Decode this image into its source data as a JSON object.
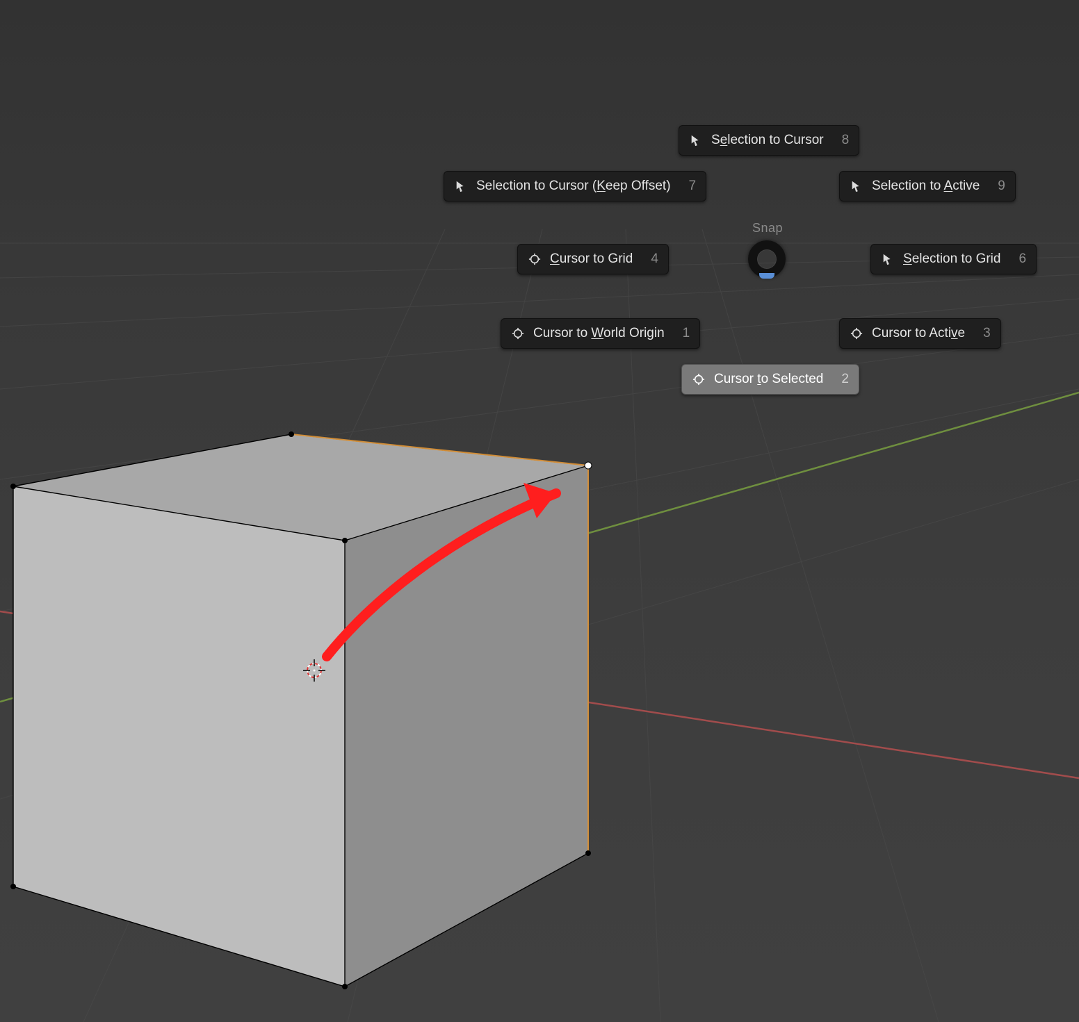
{
  "pie_menu": {
    "title": "Snap",
    "items": {
      "selection_to_cursor": {
        "label_pre": "S",
        "label_u": "e",
        "label_post": "lection to Cursor",
        "shortcut": "8",
        "icon": "cursor-arrow"
      },
      "selection_to_cursor_offset": {
        "label_pre": "Selection to Cursor (",
        "label_u": "K",
        "label_post": "eep Offset)",
        "shortcut": "7",
        "icon": "cursor-arrow"
      },
      "selection_to_active": {
        "label_pre": "Selection to ",
        "label_u": "A",
        "label_post": "ctive",
        "shortcut": "9",
        "icon": "cursor-arrow"
      },
      "cursor_to_grid": {
        "label_pre": "",
        "label_u": "C",
        "label_post": "ursor to Grid",
        "shortcut": "4",
        "icon": "cursor-target"
      },
      "selection_to_grid": {
        "label_pre": "",
        "label_u": "S",
        "label_post": "election to Grid",
        "shortcut": "6",
        "icon": "cursor-arrow"
      },
      "cursor_to_world_origin": {
        "label_pre": "Cursor to ",
        "label_u": "W",
        "label_post": "orld Origin",
        "shortcut": "1",
        "icon": "cursor-target"
      },
      "cursor_to_active": {
        "label_pre": "Cursor to Acti",
        "label_u": "v",
        "label_post": "e",
        "shortcut": "3",
        "icon": "cursor-target"
      },
      "cursor_to_selected": {
        "label_pre": "Cursor ",
        "label_u": "t",
        "label_post": "o Selected",
        "shortcut": "2",
        "icon": "cursor-target",
        "highlighted": true
      }
    }
  }
}
